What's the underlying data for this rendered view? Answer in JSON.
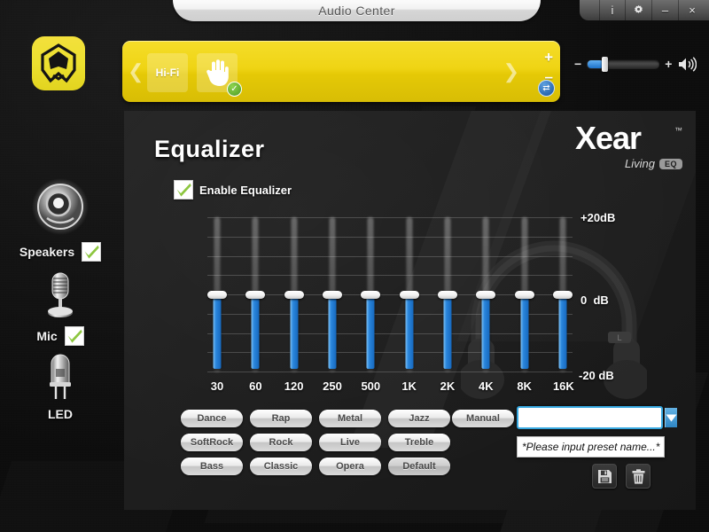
{
  "window": {
    "title": "Audio Center",
    "controls": [
      {
        "name": "info-button",
        "label": "i",
        "icon": "info-icon"
      },
      {
        "name": "settings-button",
        "label": "",
        "icon": "gear-icon"
      },
      {
        "name": "minimize-button",
        "label": "–",
        "icon": "minimize-icon"
      },
      {
        "name": "close-button",
        "label": "×",
        "icon": "close-icon"
      }
    ]
  },
  "app_logo": {
    "icon": "app-shield-icon",
    "color": "#ecd92c"
  },
  "effect_bar": {
    "prev_icon": "chevron-left-icon",
    "next_icon": "chevron-right-icon",
    "tiles": [
      {
        "name": "hifi",
        "label": "Hi-Fi",
        "checked": false
      },
      {
        "name": "hand-effect",
        "label": "",
        "icon": "hand-icon",
        "checked": true
      }
    ],
    "plus_label": "+",
    "minus_label": "–",
    "swap_icon": "swap-icon",
    "color": "#edd215"
  },
  "volume": {
    "minus_label": "−",
    "plus_label": "+",
    "level_percent": 22,
    "speaker_icon": "speaker-icon",
    "accent": "#2a86dd"
  },
  "sidebar": {
    "items": [
      {
        "name": "speakers",
        "label": "Speakers",
        "icon": "speaker-device-icon",
        "checked": true
      },
      {
        "name": "mic",
        "label": "Mic",
        "icon": "microphone-icon",
        "checked": true
      },
      {
        "name": "led",
        "label": "LED",
        "icon": "led-bulb-icon",
        "checked": false
      }
    ]
  },
  "branding": {
    "name": "Xear",
    "trademark": "™",
    "tagline": "Living",
    "badge": "EQ"
  },
  "main": {
    "title": "Equalizer",
    "enable_label": "Enable Equalizer",
    "enable_checked": true
  },
  "chart_data": {
    "type": "bar",
    "title": "Equalizer",
    "xlabel": "",
    "ylabel": "dB",
    "categories": [
      "30",
      "60",
      "120",
      "250",
      "500",
      "1K",
      "2K",
      "4K",
      "8K",
      "16K"
    ],
    "values": [
      0,
      0,
      0,
      0,
      0,
      0,
      0,
      0,
      0,
      0
    ],
    "ylim": [
      -20,
      20
    ],
    "y_tick_labels": [
      "+20dB",
      "0  dB",
      "-20 dB"
    ],
    "gridlines": 9,
    "grid": true,
    "legend": "none",
    "unit": "dB"
  },
  "presets": {
    "rows": [
      [
        "Dance",
        "Rap",
        "Metal",
        "Jazz"
      ],
      [
        "SoftRock",
        "Rock",
        "Live",
        "Treble"
      ],
      [
        "Bass",
        "Classic",
        "Opera",
        "Default"
      ]
    ],
    "manual_label": "Manual",
    "active": "Default"
  },
  "preset_name": {
    "value": "",
    "placeholder": "",
    "dropdown_icon": "chevron-down-icon",
    "tooltip": "*Please input preset name...*",
    "save_icon": "save-icon",
    "delete_icon": "trash-icon"
  }
}
